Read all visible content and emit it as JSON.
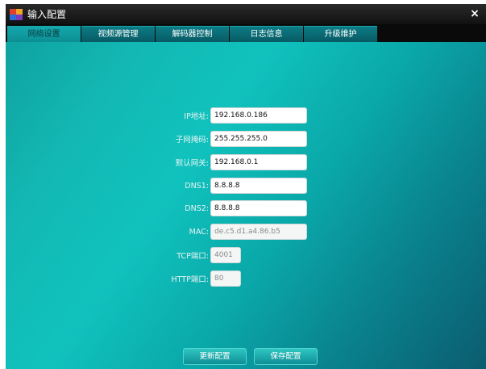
{
  "window": {
    "title": "输入配置",
    "close_glyph": "×"
  },
  "tabs": [
    {
      "label": "网络设置",
      "active": true
    },
    {
      "label": "视频源管理",
      "active": false
    },
    {
      "label": "解码器控制",
      "active": false
    },
    {
      "label": "日志信息",
      "active": false
    },
    {
      "label": "升级维护",
      "active": false
    }
  ],
  "form": {
    "ip": {
      "label": "IP地址:",
      "value": "192.168.0.186"
    },
    "subnet": {
      "label": "子网掩码:",
      "value": "255.255.255.0"
    },
    "gateway": {
      "label": "默认网关:",
      "value": "192.168.0.1"
    },
    "dns1": {
      "label": "DNS1:",
      "value": "8.8.8.8"
    },
    "dns2": {
      "label": "DNS2:",
      "value": "8.8.8.8"
    },
    "mac": {
      "label": "MAC:",
      "value": "de.c5.d1.a4.86.b5"
    },
    "tcp_port": {
      "label": "TCP端口:",
      "value": "4001"
    },
    "http_port": {
      "label": "HTTP端口:",
      "value": "80"
    }
  },
  "buttons": {
    "update": "更新配置",
    "save": "保存配置"
  }
}
